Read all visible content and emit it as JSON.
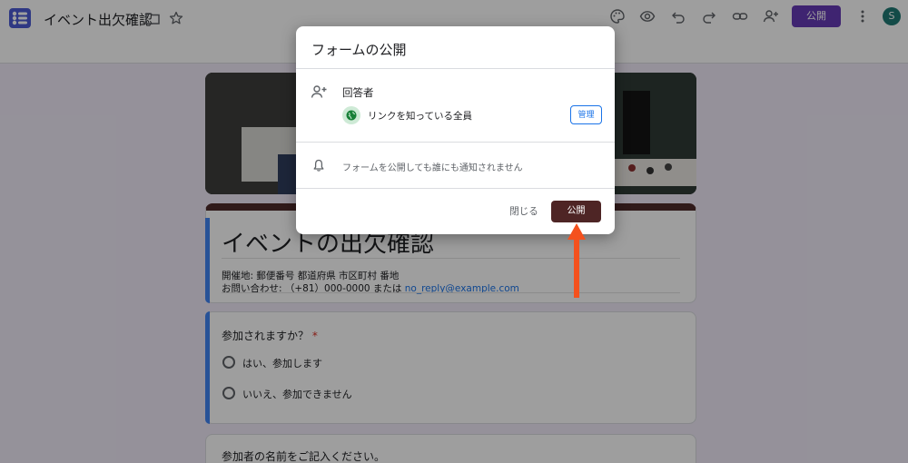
{
  "topbar": {
    "doc_title": "イベント出欠確認",
    "publish_label": "公開",
    "avatar_initial": "S",
    "icons": [
      "palette-icon",
      "preview-eye-icon",
      "undo-icon",
      "redo-icon",
      "link-icon",
      "add-collaborator-icon"
    ]
  },
  "form": {
    "title": "イベントの出欠確認",
    "description_line1": "開催地: 郵便番号 都道府県 市区町村 番地",
    "description_line2_prefix": "お問い合わせ: （+81）000-0000 または ",
    "contact_email": "no_reply@example.com",
    "question1": {
      "label": "参加されますか？",
      "required_mark": "*",
      "options": [
        "はい、参加します",
        "いいえ、参加できません"
      ]
    },
    "question2_label": "参加者の名前をご記入ください。"
  },
  "dialog": {
    "title": "フォームの公開",
    "responders_heading": "回答者",
    "link_access_label": "リンクを知っている全員",
    "manage_label": "管理",
    "notification_text": "フォームを公開しても誰にも通知されません",
    "close_label": "閉じる",
    "publish_label": "公開"
  },
  "colors": {
    "accent_purple": "#673ab7",
    "theme_brown": "#4e2525",
    "link_blue": "#1a73e8",
    "annotation_arrow": "#f4511e"
  }
}
